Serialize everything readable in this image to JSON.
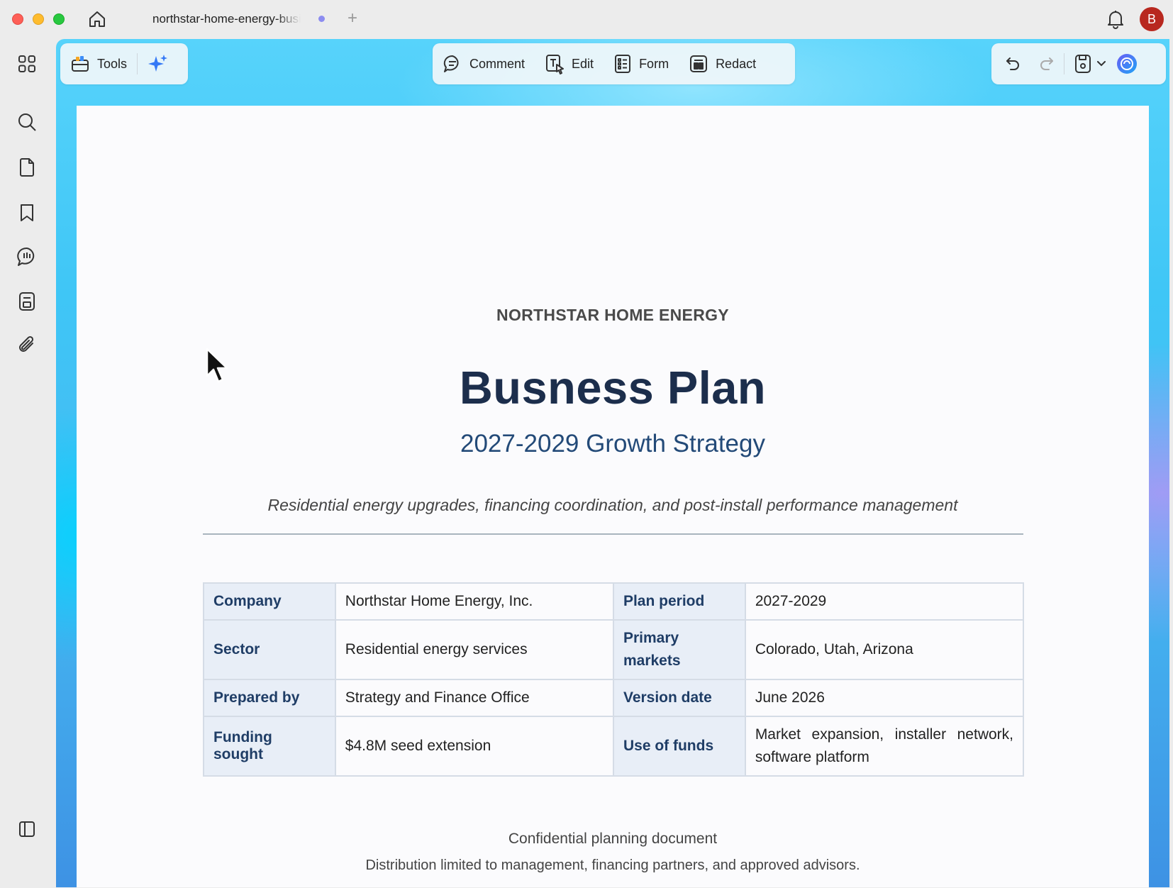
{
  "window": {
    "tab_title": "northstar-home-energy-business-plan",
    "avatar_initial": "B",
    "new_tab_symbol": "+"
  },
  "toolbar": {
    "tools_label": "Tools",
    "modes": [
      {
        "label": "Comment",
        "icon": "comment-icon"
      },
      {
        "label": "Edit",
        "icon": "edit-text-icon"
      },
      {
        "label": "Form",
        "icon": "form-icon"
      },
      {
        "label": "Redact",
        "icon": "redact-icon"
      }
    ]
  },
  "sidebar": {
    "icons": [
      "apps-grid-icon",
      "search-icon",
      "page-icon",
      "bookmark-icon",
      "comments-icon",
      "save-document-icon",
      "attachment-icon",
      "panel-toggle-icon"
    ]
  },
  "document": {
    "company_line": "NORTHSTAR HOME ENERGY",
    "title": "Busness Plan",
    "subtitle": "2027-2029 Growth Strategy",
    "tagline": "Residential energy upgrades, financing coordination, and post-install performance management",
    "info_table": {
      "company_label": "Company",
      "company_value": "Northstar Home Energy, Inc.",
      "plan_period_label": "Plan period",
      "plan_period_value": "2027-2029",
      "sector_label": "Sector",
      "sector_value": "Residential energy services",
      "primary_markets_label": "Primary markets",
      "primary_markets_value": "Colorado, Utah, Arizona",
      "prepared_by_label": "Prepared by",
      "prepared_by_value": "Strategy and Finance Office",
      "version_date_label": "Version date",
      "version_date_value": "June 2026",
      "funding_label": "Funding sought",
      "funding_value": "$4.8M seed extension",
      "use_of_funds_label": "Use of funds",
      "use_of_funds_value": "Market expansion, installer network, software platform"
    },
    "confidential_note": "Confidential planning document",
    "distribution_note": "Distribution limited to management, financing partners, and approved advisors."
  },
  "colors": {
    "title": "#1c2e4c",
    "subtitle": "#234a78",
    "label_cell_bg": "#e8eef7",
    "label_text": "#1f3d66",
    "avatar": "#b8281f",
    "canvas_accent": "#3fc6f6"
  }
}
